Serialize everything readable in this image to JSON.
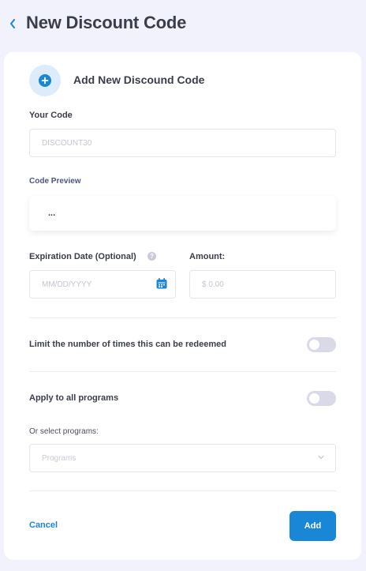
{
  "header": {
    "back_icon": "chevron-left-icon",
    "title": "New Discount Code"
  },
  "card": {
    "add_icon": "plus-circle-icon",
    "heading": "Add New Discound Code"
  },
  "code": {
    "label": "Your Code",
    "placeholder": "DISCOUNT30"
  },
  "preview": {
    "label": "Code Preview",
    "value": "..."
  },
  "expiration": {
    "label": "Expiration Date (Optional)",
    "help": "?",
    "placeholder": "MM/DD/YYYY",
    "icon": "calendar-icon"
  },
  "amount": {
    "label": "Amount:",
    "placeholder": "$ 0.00"
  },
  "limit": {
    "label": "Limit the number of times this can be redeemed",
    "enabled": false
  },
  "programs": {
    "apply_all_label": "Apply to all programs",
    "apply_all_enabled": false,
    "select_label": "Or select programs:",
    "select_placeholder": "Programs",
    "chevron_icon": "chevron-down-icon"
  },
  "actions": {
    "cancel_label": "Cancel",
    "add_label": "Add"
  },
  "colors": {
    "accent": "#1a86d6",
    "background": "#f1f2fb",
    "toggle_off": "#d9d9e8"
  }
}
